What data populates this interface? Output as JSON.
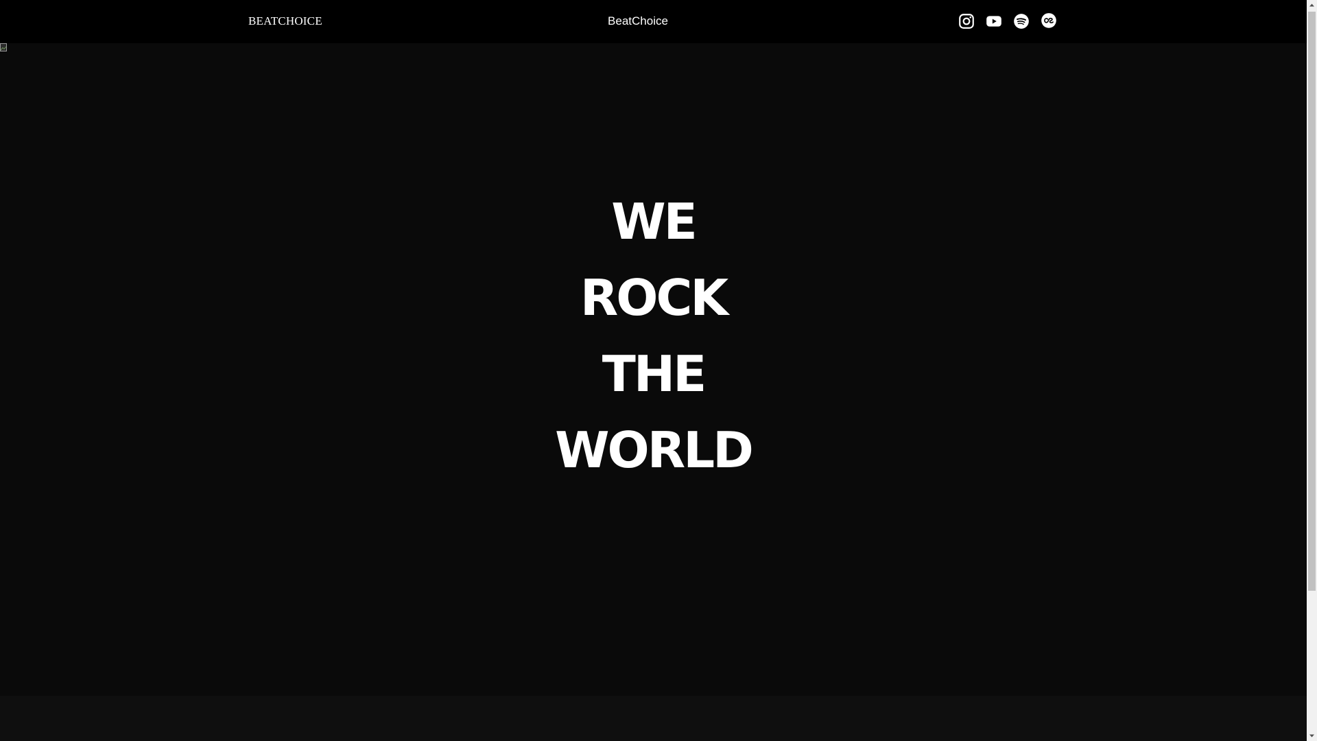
{
  "header": {
    "brand": "BEATCHOICE",
    "center_title": "BeatChoice",
    "socials": [
      {
        "name": "instagram-icon"
      },
      {
        "name": "youtube-icon"
      },
      {
        "name": "spotify-icon"
      },
      {
        "name": "lastfm-icon"
      }
    ]
  },
  "hero": {
    "lines": [
      "WE",
      "ROCK",
      "THE",
      "WORLD"
    ],
    "image": {
      "state": "broken-image-icon"
    }
  },
  "colors": {
    "header_bg": "#000000",
    "hero_bg": "#0a0a0a",
    "text": "#ffffff",
    "scrollbar_track": "#f1f1f1",
    "scrollbar_thumb": "#c1c1c1"
  }
}
